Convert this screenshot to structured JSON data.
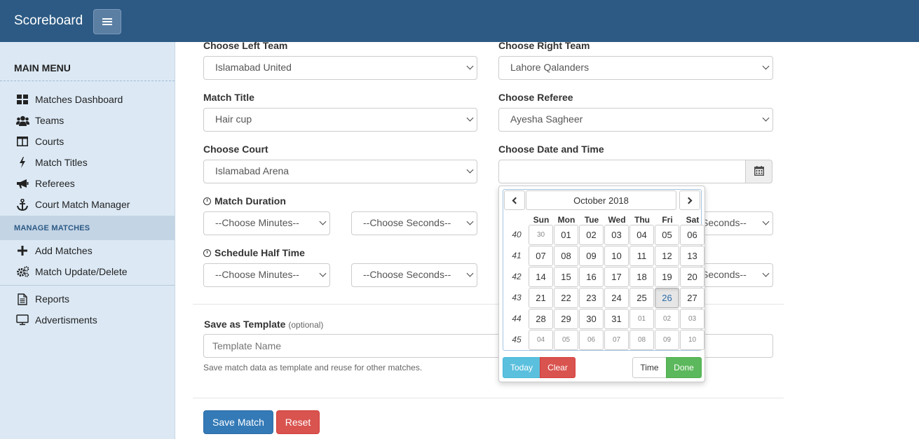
{
  "app": {
    "title": "Scoreboard"
  },
  "sidebar": {
    "heading": "MAIN MENU",
    "items": [
      {
        "label": "Matches Dashboard",
        "icon": "dashboard-icon"
      },
      {
        "label": "Teams",
        "icon": "users-icon"
      },
      {
        "label": "Courts",
        "icon": "columns-icon"
      },
      {
        "label": "Match Titles",
        "icon": "bolt-icon"
      },
      {
        "label": "Referees",
        "icon": "bullhorn-icon"
      },
      {
        "label": "Court Match Manager",
        "icon": "anchor-icon"
      }
    ],
    "section": "MANAGE MATCHES",
    "manage_items": [
      {
        "label": "Add Matches",
        "icon": "plus-icon"
      },
      {
        "label": "Match Update/Delete",
        "icon": "cogs-icon"
      }
    ],
    "bottom_items": [
      {
        "label": "Reports",
        "icon": "file-icon"
      },
      {
        "label": "Advertisments",
        "icon": "monitor-icon"
      }
    ]
  },
  "form": {
    "left_team": {
      "label": "Choose Left Team",
      "value": "Islamabad United"
    },
    "right_team": {
      "label": "Choose Right Team",
      "value": "Lahore Qalanders"
    },
    "match_title": {
      "label": "Match Title",
      "value": "Hair cup"
    },
    "referee": {
      "label": "Choose Referee",
      "value": "Ayesha Sagheer"
    },
    "court": {
      "label": "Choose Court",
      "value": "Islamabad Arena"
    },
    "datetime": {
      "label": "Choose Date and Time",
      "value": ""
    },
    "match_duration": {
      "label": "Match Duration",
      "minutes": "--Choose Minutes--",
      "seconds": "--Choose Seconds--",
      "right_seconds": "Seconds--"
    },
    "half_time": {
      "label": "Schedule Half Time",
      "minutes": "--Choose Minutes--",
      "seconds": "--Choose Seconds--",
      "right_seconds": "Seconds--"
    },
    "template": {
      "label": "Save as Template",
      "optional": "(optional)",
      "placeholder": "Template Name",
      "help": "Save match data as template and reuse for other matches."
    },
    "save_label": "Save Match",
    "reset_label": "Reset"
  },
  "datepicker": {
    "title": "October 2018",
    "weekdays": [
      "Sun",
      "Mon",
      "Tue",
      "Wed",
      "Thu",
      "Fri",
      "Sat"
    ],
    "weeks": [
      "40",
      "41",
      "42",
      "43",
      "44",
      "45"
    ],
    "days": [
      [
        "30",
        "01",
        "02",
        "03",
        "04",
        "05",
        "06"
      ],
      [
        "07",
        "08",
        "09",
        "10",
        "11",
        "12",
        "13"
      ],
      [
        "14",
        "15",
        "16",
        "17",
        "18",
        "19",
        "20"
      ],
      [
        "21",
        "22",
        "23",
        "24",
        "25",
        "26",
        "27"
      ],
      [
        "28",
        "29",
        "30",
        "31",
        "01",
        "02",
        "03"
      ],
      [
        "04",
        "05",
        "06",
        "07",
        "08",
        "09",
        "10"
      ]
    ],
    "selected": "26",
    "today_label": "Today",
    "clear_label": "Clear",
    "time_label": "Time",
    "done_label": "Done"
  },
  "colors": {
    "topbar": "#2c5a84",
    "sidebar": "#dce9f5",
    "primary": "#337ab7",
    "danger": "#d9534f",
    "info": "#5bc0de",
    "success": "#5cb85c"
  }
}
